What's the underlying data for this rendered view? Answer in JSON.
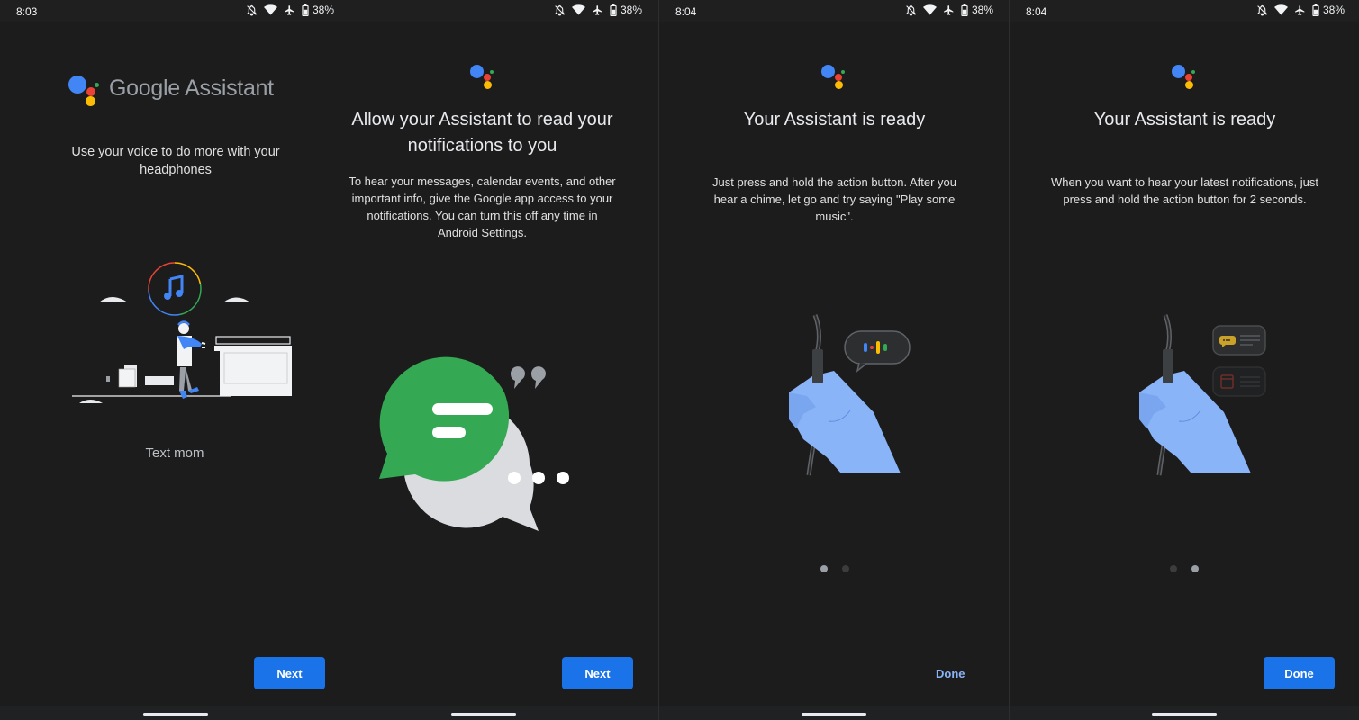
{
  "colors": {
    "background": "#1c1c1d",
    "primary_button": "#1a73e8",
    "text_button": "#8ab4f8",
    "assistant_blue": "#4285f4",
    "assistant_red": "#ea4335",
    "assistant_yellow": "#fbbc04",
    "assistant_green": "#34a853"
  },
  "panels": [
    {
      "status": {
        "time": "8:03",
        "battery": "38%",
        "icons": [
          "do-not-disturb-off-icon",
          "wifi-icon",
          "airplane-icon",
          "battery-icon"
        ]
      },
      "logo": {
        "wordmark": "Google Assistant"
      },
      "subtitle": "Use your voice to do more with your headphones",
      "illustration": "person-dancing-with-headphones",
      "caption": "Text mom",
      "button": {
        "label": "Next",
        "style": "filled"
      }
    },
    {
      "status": {
        "time": "",
        "battery": "38%",
        "icons": [
          "do-not-disturb-off-icon",
          "wifi-icon",
          "airplane-icon",
          "battery-icon"
        ]
      },
      "title": "Allow your Assistant to read your notifications to you",
      "body": "To hear your messages, calendar events, and other important info, give the Google app access to your notifications. You can turn this off any time in Android Settings.",
      "illustration": "chat-bubbles",
      "button": {
        "label": "Next",
        "style": "filled"
      }
    },
    {
      "status": {
        "time": "8:04",
        "battery": "38%",
        "icons": [
          "do-not-disturb-off-icon",
          "wifi-icon",
          "airplane-icon",
          "battery-icon"
        ]
      },
      "title": "Your Assistant is ready",
      "body": "Just press and hold the action button. After you hear a chime, let go and try saying \"Play some music\".",
      "illustration": "hand-holding-headphone-cable-with-voice-bubble",
      "pager": {
        "total": 2,
        "active": 1
      },
      "button": {
        "label": "Done",
        "style": "text"
      }
    },
    {
      "status": {
        "time": "8:04",
        "battery": "38%",
        "icons": [
          "do-not-disturb-off-icon",
          "wifi-icon",
          "airplane-icon",
          "battery-icon"
        ]
      },
      "title": "Your Assistant is ready",
      "body": "When you want to hear your latest notifications, just press and hold the action button for 2 seconds.",
      "illustration": "hand-holding-headphone-cable-with-notification-cards",
      "pager": {
        "total": 2,
        "active": 2
      },
      "button": {
        "label": "Done",
        "style": "filled"
      }
    }
  ]
}
